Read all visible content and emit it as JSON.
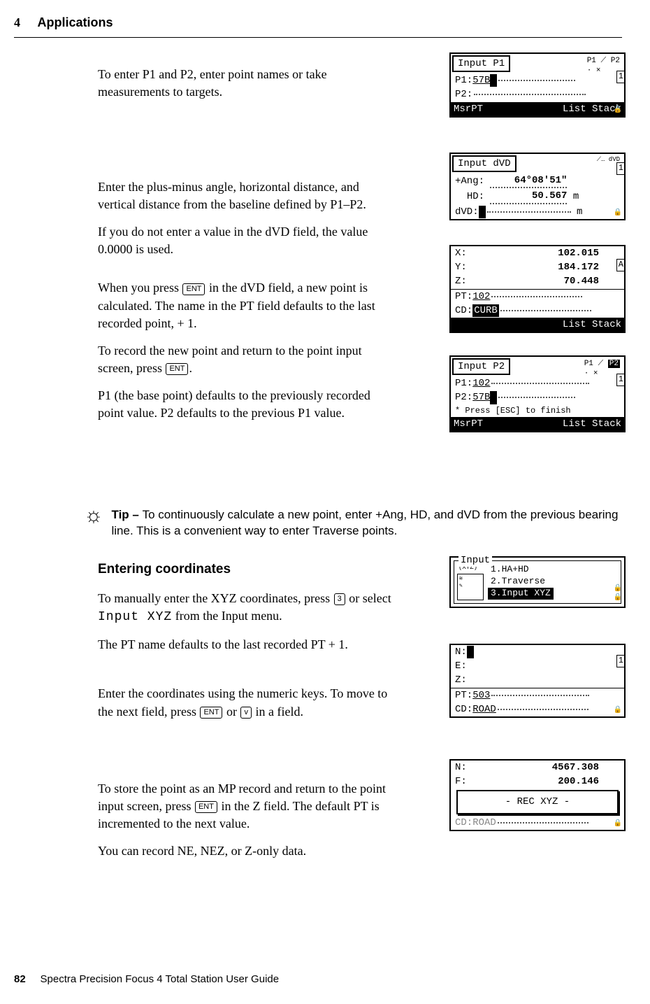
{
  "header": {
    "chapter_num": "4",
    "chapter_title": "Applications"
  },
  "footer": {
    "page_num": "82",
    "guide_title": "Spectra Precision Focus 4 Total Station User Guide"
  },
  "para1": "To enter P1 and P2, enter point names or take measurements to targets.",
  "para2": "Enter the plus-minus angle, horizontal distance, and vertical distance from the baseline defined by P1–P2.",
  "para3": "If you do not enter a value in the dVD field, the value 0.0000 is used.",
  "para4a": "When you press ",
  "para4b": " in the dVD field, a new point is calculated. The name in the PT field defaults to the last recorded point, + 1.",
  "para5a": "To record the new point and return to the point input screen, press ",
  "para5b": ".",
  "para6": "P1 (the base point) defaults to the previously recorded point value. P2 defaults to the previous P1 value.",
  "tip": {
    "label": "Tip – ",
    "text": "To continuously calculate a new point, enter +Ang, HD, and dVD from the previous bearing line. This is a convenient way to enter Traverse points."
  },
  "sub1": "Entering coordinates",
  "para7a": "To manually enter the XYZ coordinates, press ",
  "para7b": " or select ",
  "para7c": " from the Input menu.",
  "para7_code": "Input XYZ",
  "para8": "The PT name defaults to the last recorded PT + 1.",
  "para9a": "Enter the coordinates using the numeric keys. To move to the next field, press ",
  "para9b": " or ",
  "para9c": " in a field.",
  "para10a": "To store the point as an MP record and return to the point input screen, press ",
  "para10b": " in the Z field. The default PT is incremented to the next value.",
  "para11": "You can record NE, NEZ, or Z-only data.",
  "keys": {
    "ent": "ENT",
    "three": "3",
    "down": "v"
  },
  "screen1": {
    "title": "Input P1",
    "corner_p1": "P1",
    "corner_p2": "P2",
    "p1_label": "P1:",
    "p1_val": "57B",
    "p2_label": "P2:",
    "bot_left": "MsrPT",
    "bot_right": "List Stack"
  },
  "screen2": {
    "title": "Input dVD",
    "corner": "dVD",
    "ang_label": "+Ang:",
    "ang_val": "64°08'51\"",
    "hd_label": "HD:",
    "hd_val": "50.567",
    "hd_unit": "m",
    "dvd_label": "dVD:",
    "dvd_unit": "m"
  },
  "screen3": {
    "x_label": "X:",
    "x_val": "102.015",
    "y_label": "Y:",
    "y_val": "184.172",
    "z_label": "Z:",
    "z_val": "70.448",
    "pt_label": "PT:",
    "pt_val": "102",
    "cd_label": "CD:",
    "cd_val": "CURB",
    "bot_right": "List Stack",
    "side": "A"
  },
  "screen4": {
    "title": "Input P2",
    "corner_p1": "P1",
    "corner_p2": "P2",
    "p1_label": "P1:",
    "p1_val": "102",
    "p2_label": "P2:",
    "p2_val": "57B",
    "hint": "* Press [ESC] to finish",
    "bot_left": "MsrPT",
    "bot_right": "List Stack"
  },
  "screen5": {
    "group": "Input",
    "xyz_small": "(XYZ)",
    "opt1": "1.HA+HD",
    "opt2": "2.Traverse",
    "opt3": "3.Input XYZ"
  },
  "screen6": {
    "n_label": "N:",
    "e_label": "E:",
    "z_label": "Z:",
    "pt_label": "PT:",
    "pt_val": "503",
    "cd_label": "CD:",
    "cd_val": "ROAD"
  },
  "screen7": {
    "n_label": "N:",
    "n_val": "4567.308",
    "f_label": "F:",
    "f_val": "200.146",
    "rec": "- REC XYZ -",
    "cd_label": "CD:",
    "cd_val": "ROAD"
  }
}
